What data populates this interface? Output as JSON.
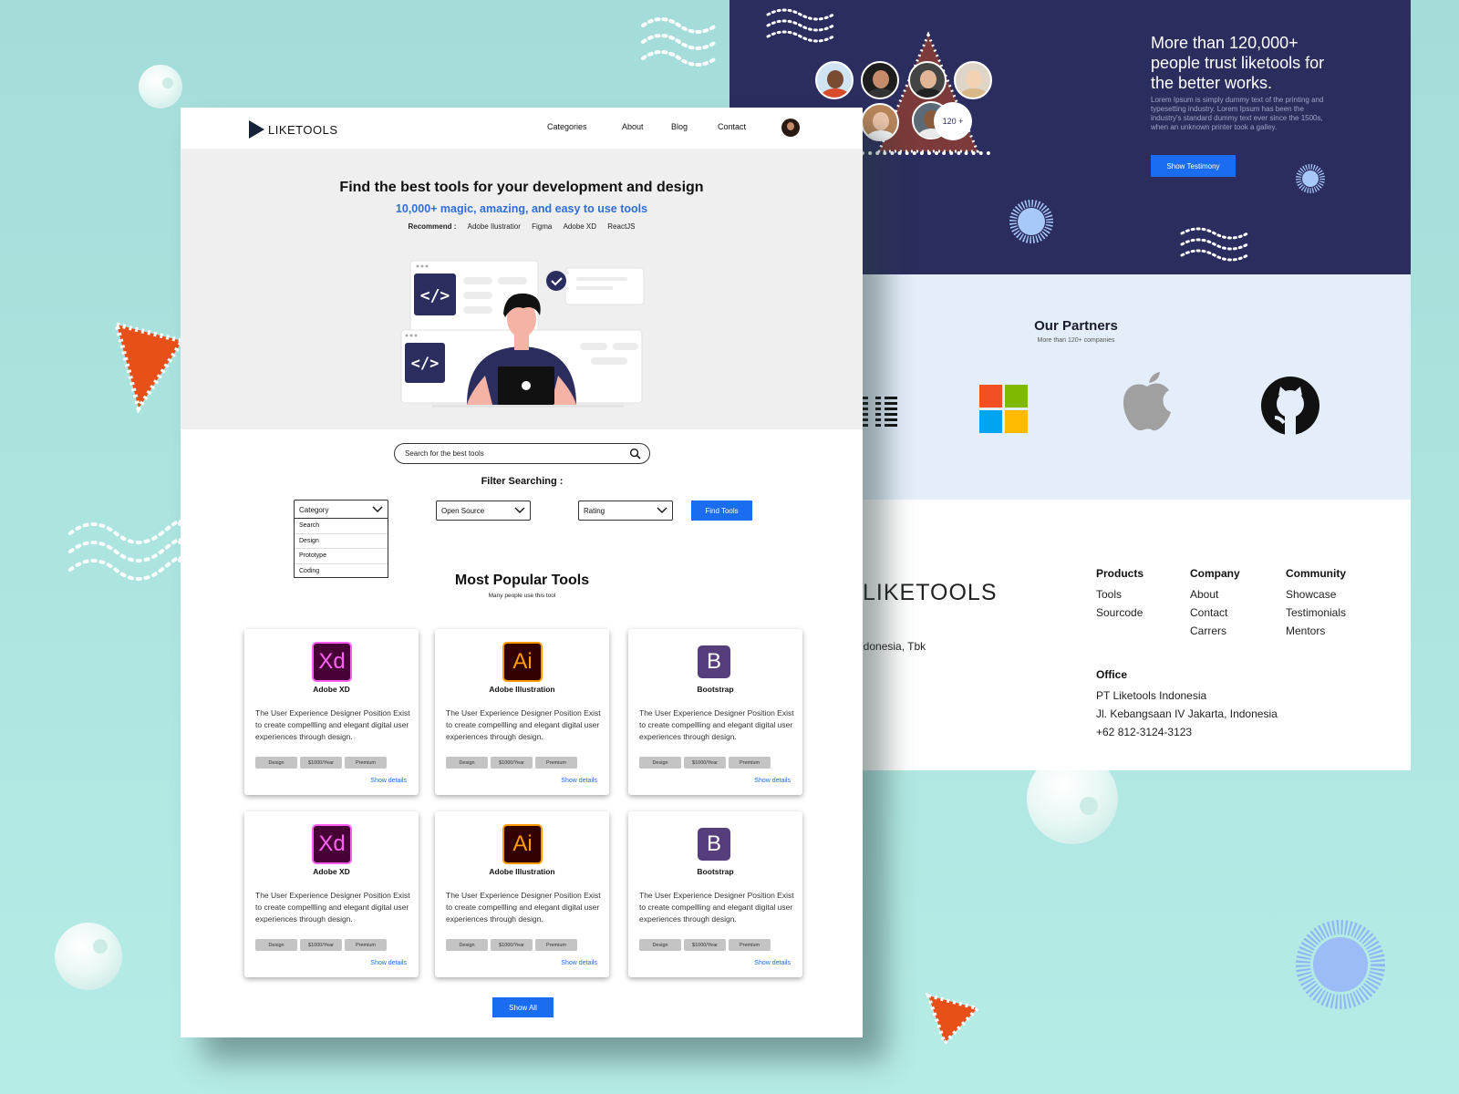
{
  "front": {
    "brand": "LIKETOOLS",
    "nav": [
      "Categories",
      "About",
      "Blog",
      "Contact"
    ],
    "hero": {
      "title": "Find the best tools for your development and design",
      "subtitle": "10,000+ magic, amazing, and easy to use tools",
      "recommend_label": "Recommend :",
      "recommend_items": [
        "Adobe Ilustratior",
        "Figma",
        "Adobe XD",
        "ReactJS"
      ]
    },
    "search": {
      "placeholder": "Search for the best tools"
    },
    "filter": {
      "title": "Filter Searching :",
      "category": "Category",
      "category_options": [
        "Search",
        "Design",
        "Prototype",
        "Coding"
      ],
      "license": "Open Source",
      "rating": "Rating",
      "button": "Find Tools"
    },
    "popular": {
      "title": "Most Popular Tools",
      "subtitle": "Many people use this tool",
      "cards": [
        {
          "name": "Adobe XD",
          "logo": "Xd",
          "desc": "The User Experience Designer Position Exist to create compellling and elegant digital user experiences through design.",
          "tags": [
            "Design",
            "$1000/Year",
            "Premium"
          ],
          "link": "Show details"
        },
        {
          "name": "Adobe Illustration",
          "logo": "Ai",
          "desc": "The User Experience Designer Position Exist to create compellling and elegant digital user experiences through design.",
          "tags": [
            "Design",
            "$1000/Year",
            "Premium"
          ],
          "link": "Show details"
        },
        {
          "name": "Bootstrap",
          "logo": "B",
          "desc": "The User Experience Designer Position Exist to create compellling and elegant digital user experiences through design.",
          "tags": [
            "Design",
            "$1000/Year",
            "Premium"
          ],
          "link": "Show details"
        },
        {
          "name": "Adobe XD",
          "logo": "Xd",
          "desc": "The User Experience Designer Position Exist to create compellling and elegant digital user experiences through design.",
          "tags": [
            "Design",
            "$1000/Year",
            "Premium"
          ],
          "link": "Show details"
        },
        {
          "name": "Adobe Illustration",
          "logo": "Ai",
          "desc": "The User Experience Designer Position Exist to create compellling and elegant digital user experiences through design.",
          "tags": [
            "Design",
            "$1000/Year",
            "Premium"
          ],
          "link": "Show details"
        },
        {
          "name": "Bootstrap",
          "logo": "B",
          "desc": "The User Experience Designer Position Exist to create compellling and elegant digital user experiences through design.",
          "tags": [
            "Design",
            "$1000/Year",
            "Premium"
          ],
          "link": "Show details"
        }
      ],
      "show_all": "Show All"
    }
  },
  "back": {
    "testimony": {
      "count": "120 +",
      "title": "More than 120,000+ people trust liketools for the better works.",
      "text": "Lorem Ipsum is simply dummy text of the printing and typesetting industry. Lorem Ipsum has been the industry's standard dummy text ever since the 1500s, when an unknown printer took a galley.",
      "button": "Show Testimony"
    },
    "partners": {
      "title": "Our Partners",
      "subtitle": "More than 120+ companies",
      "logos": [
        "ibm-logo",
        "microsoft-logo",
        "apple-logo",
        "github-logo"
      ]
    },
    "footer": {
      "logo": "LIKETOOLS",
      "company_partial": "ndonesia, Tbk",
      "products": {
        "title": "Products",
        "items": [
          "Tools",
          "Sourcode"
        ]
      },
      "company": {
        "title": "Company",
        "items": [
          "About",
          "Contact",
          "Carrers"
        ]
      },
      "community": {
        "title": "Community",
        "items": [
          "Showcase",
          "Testimonials",
          "Mentors"
        ]
      },
      "office": {
        "title": "Office",
        "lines": [
          "PT Liketools Indonesia",
          "Jl. Kebangsaan IV Jakarta, Indonesia",
          "+62 812-3124-3123"
        ]
      }
    }
  },
  "colors": {
    "background": "#a3dcd9",
    "navy": "#2b2d5e",
    "accent_blue": "#1a6cf0",
    "orange": "#e8501a",
    "partners_bg": "#e4eefa"
  }
}
